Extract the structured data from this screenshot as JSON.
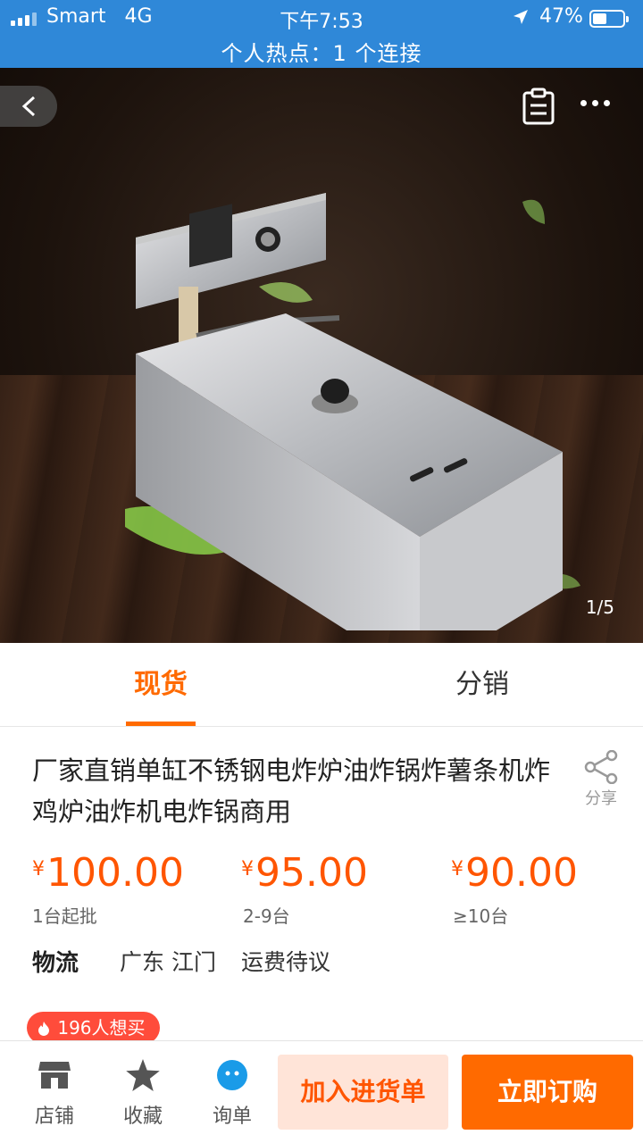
{
  "status_bar": {
    "carrier": "Smart",
    "network": "4G",
    "time": "下午7:53",
    "battery": "47%",
    "battery_level": 0.47,
    "hotspot": "个人热点：1 个连接"
  },
  "gallery": {
    "counter": "1/5",
    "icons": [
      "back-icon",
      "clipboard-icon",
      "more-icon"
    ]
  },
  "tabs": [
    {
      "label": "现货",
      "active": true
    },
    {
      "label": "分销",
      "active": false
    }
  ],
  "product": {
    "title": "厂家直销单缸不锈钢电炸炉油炸锅炸薯条机炸鸡炉油炸机电炸锅商用",
    "share_label": "分享"
  },
  "prices": [
    {
      "currency": "¥",
      "amount": "100.00",
      "tier": "1台起批"
    },
    {
      "currency": "¥",
      "amount": "95.00",
      "tier": "2-9台"
    },
    {
      "currency": "¥",
      "amount": "90.00",
      "tier": "≥10台"
    }
  ],
  "logistics": {
    "label": "物流",
    "location": "广东 江门",
    "fee": "运费待议"
  },
  "popularity": "196人想买",
  "bottom_bar": {
    "store": "店铺",
    "favorite": "收藏",
    "inquiry": "询单",
    "add_cart": "加入进货单",
    "buy_now": "立即订购"
  },
  "colors": {
    "accent": "#ff6a00",
    "price": "#ff5500",
    "status_bar": "#2f88d8"
  }
}
